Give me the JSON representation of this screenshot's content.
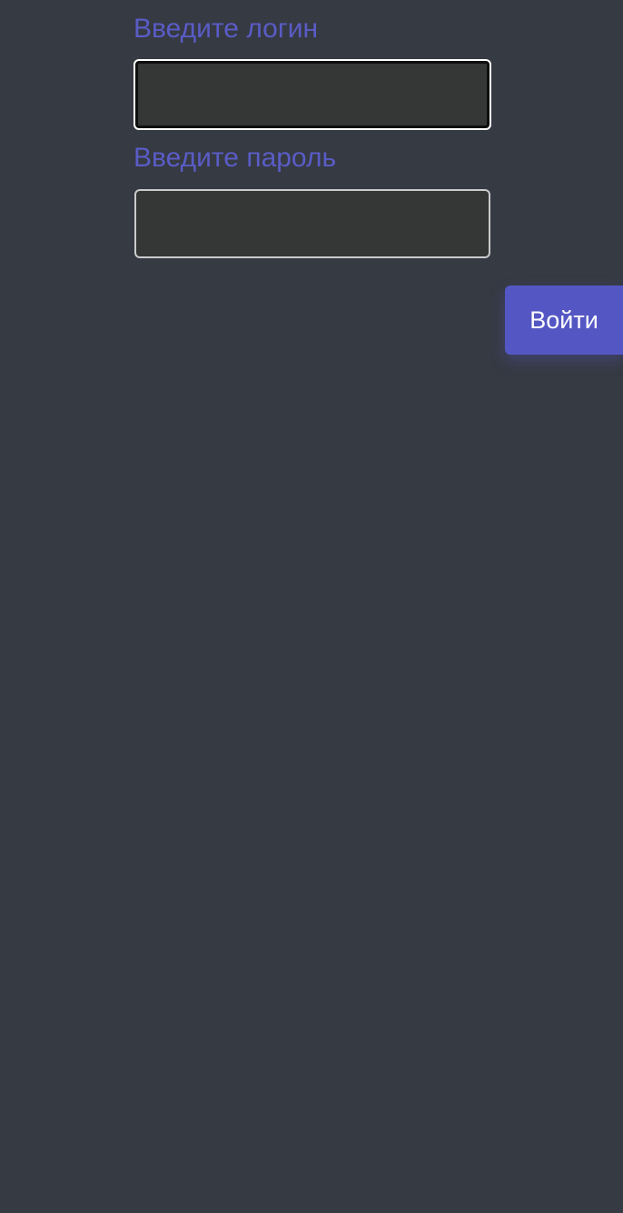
{
  "colors": {
    "background": "#363a43",
    "label": "#5a5cc6",
    "input_background": "#343735",
    "button": "#5457c3",
    "button_text": "#ffffff"
  },
  "login": {
    "label": "Введите логин",
    "value": ""
  },
  "password": {
    "label": "Введите пароль",
    "value": ""
  },
  "submit": {
    "label": "Войти"
  }
}
